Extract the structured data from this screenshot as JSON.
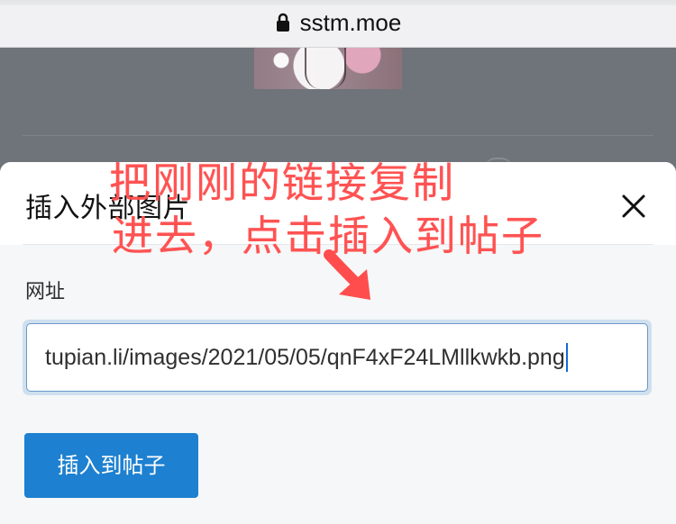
{
  "browser": {
    "url": "sstm.moe"
  },
  "modal": {
    "title": "插入外部图片",
    "field_label": "网址",
    "url_value": "tupian.li/images/2021/05/05/qnF4xF24LMllkwkb.png",
    "insert_button": "插入到帖子"
  },
  "annotation": {
    "line_1": "把刚刚的链接复制",
    "line_2": "进去，点击插入到帖子"
  },
  "icons": {
    "lock": "lock-icon",
    "close": "close-icon",
    "arrow": "arrow-icon"
  },
  "colors": {
    "accent": "#1d80d0",
    "annotation": "#ff5252",
    "overlay": "#6f737a"
  }
}
